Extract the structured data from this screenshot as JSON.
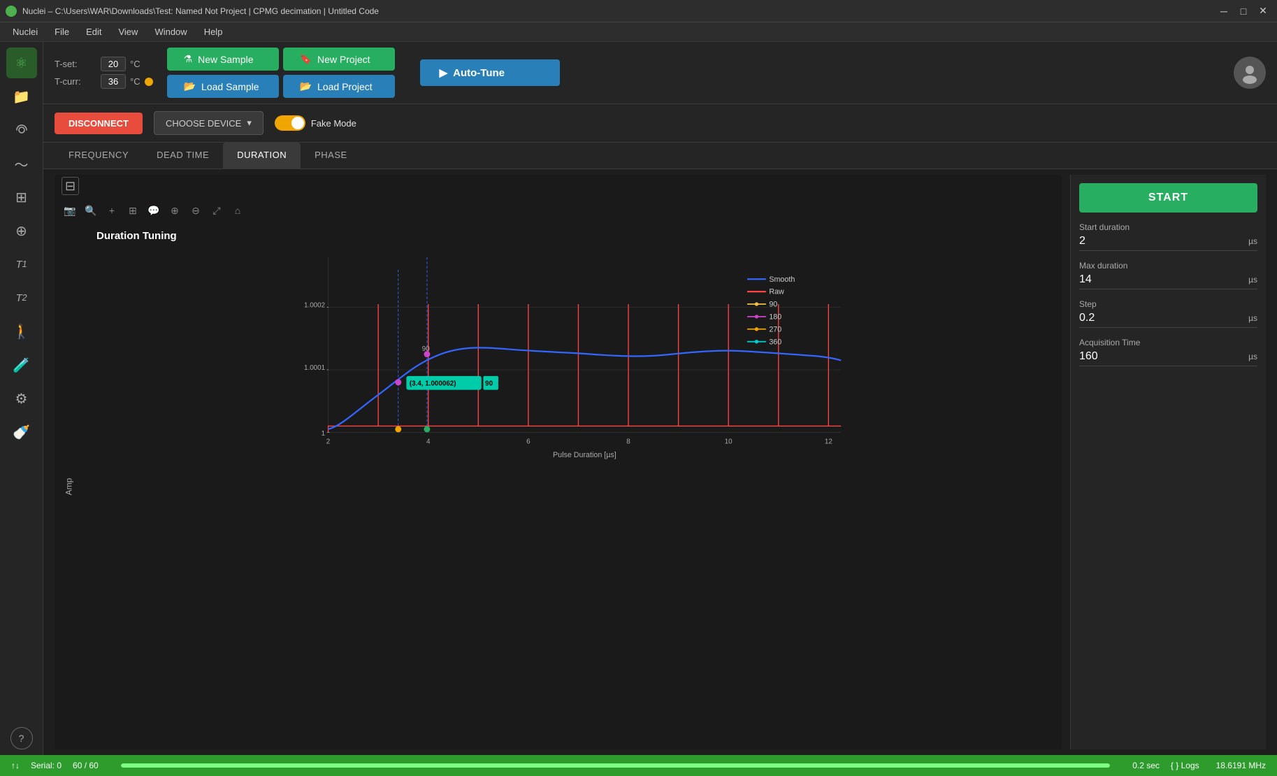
{
  "titlebar": {
    "title": "Nuclei – C:\\Users\\WAR\\Downloads\\Test: Named Not Project | CPMG decimation | Untitled Code",
    "icon": "nuclei-icon"
  },
  "menubar": {
    "items": [
      "Nuclei",
      "File",
      "Edit",
      "View",
      "Window",
      "Help"
    ]
  },
  "header": {
    "temp_set_label": "T-set:",
    "temp_set_value": "20",
    "temp_curr_label": "T-curr:",
    "temp_curr_value": "36",
    "temp_unit": "°C",
    "new_sample_label": "New Sample",
    "load_sample_label": "Load Sample",
    "new_project_label": "New Project",
    "load_project_label": "Load Project",
    "autotune_label": "Auto-Tune"
  },
  "device_bar": {
    "disconnect_label": "DISCONNECT",
    "choose_device_label": "CHOOSE DEVICE",
    "fake_mode_label": "Fake Mode"
  },
  "tabs": {
    "items": [
      "FREQUENCY",
      "DEAD TIME",
      "DURATION",
      "PHASE"
    ],
    "active": 2
  },
  "chart": {
    "title": "Duration Tuning",
    "x_label": "Pulse Duration [µs]",
    "y_label": "Amp",
    "x_min": 2,
    "x_max": 14,
    "y_min": 1.0,
    "y_max": 1.0002,
    "tooltip_text": "(3.4, 1.000062)",
    "tooltip_label": "90",
    "legend": [
      {
        "label": "Smooth",
        "color": "#3366ff"
      },
      {
        "label": "Raw",
        "color": "#ff4444"
      },
      {
        "label": "90",
        "color": "#f0c040"
      },
      {
        "label": "180",
        "color": "#cc44cc"
      },
      {
        "label": "270",
        "color": "#f0a500"
      },
      {
        "label": "360",
        "color": "#00cccc"
      }
    ]
  },
  "right_panel": {
    "start_label": "START",
    "start_duration_label": "Start duration",
    "start_duration_value": "2",
    "start_duration_unit": "µs",
    "max_duration_label": "Max duration",
    "max_duration_value": "14",
    "max_duration_unit": "µs",
    "step_label": "Step",
    "step_value": "0.2",
    "step_unit": "µs",
    "acq_time_label": "Acquisition Time",
    "acq_time_value": "160",
    "acq_time_unit": "µs"
  },
  "status_bar": {
    "arrows_icon": "↑↓",
    "serial_label": "Serial: 0",
    "progress_text": "60 / 60",
    "progress_pct": 100,
    "time_value": "0.2 sec",
    "logs_label": "{ } Logs",
    "freq_value": "18.6191 MHz"
  },
  "sidebar": {
    "icons": [
      {
        "name": "home-icon",
        "symbol": "⚛",
        "active": true
      },
      {
        "name": "folder-icon",
        "symbol": "📁",
        "active": false
      },
      {
        "name": "wifi-icon",
        "symbol": "◉",
        "active": false
      },
      {
        "name": "chart-icon",
        "symbol": "〜",
        "active": false
      },
      {
        "name": "dashboard-icon",
        "symbol": "⊞",
        "active": false
      },
      {
        "name": "add-icon",
        "symbol": "⊞",
        "active": false
      },
      {
        "name": "t1-icon",
        "symbol": "T₁",
        "active": false
      },
      {
        "name": "t2-icon",
        "symbol": "T₂",
        "active": false
      },
      {
        "name": "person-icon",
        "symbol": "🏃",
        "active": false
      },
      {
        "name": "tube-icon",
        "symbol": "🧪",
        "active": false
      },
      {
        "name": "settings-icon",
        "symbol": "⚙",
        "active": false
      },
      {
        "name": "baby-icon",
        "symbol": "🍼",
        "active": false
      },
      {
        "name": "help-icon",
        "symbol": "?",
        "active": false
      }
    ]
  }
}
